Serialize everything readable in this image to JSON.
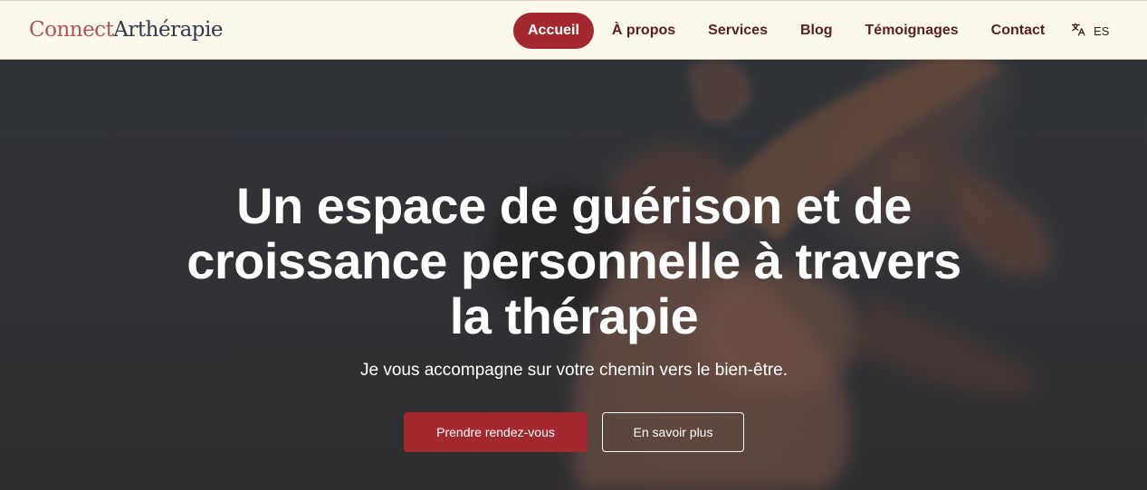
{
  "header": {
    "logo": {
      "part1": "Connect",
      "part2": "Arthérapie"
    },
    "nav": [
      {
        "label": "Accueil",
        "active": true
      },
      {
        "label": "À propos",
        "active": false
      },
      {
        "label": "Services",
        "active": false
      },
      {
        "label": "Blog",
        "active": false
      },
      {
        "label": "Témoignages",
        "active": false
      },
      {
        "label": "Contact",
        "active": false
      }
    ],
    "language": {
      "icon": "translate-icon",
      "label": "ES"
    }
  },
  "hero": {
    "title": "Un espace de guérison et de croissance personnelle à travers la thérapie",
    "subtitle": "Je vous accompagne sur votre chemin vers le bien-être.",
    "primary_button": "Prendre rendez-vous",
    "secondary_button": "En savoir plus"
  },
  "colors": {
    "accent": "#a4282f",
    "header_bg": "#fdf8ec",
    "nav_text": "#5a1d22",
    "logo_part1": "#b1545a",
    "logo_part2": "#2f3a4a"
  }
}
